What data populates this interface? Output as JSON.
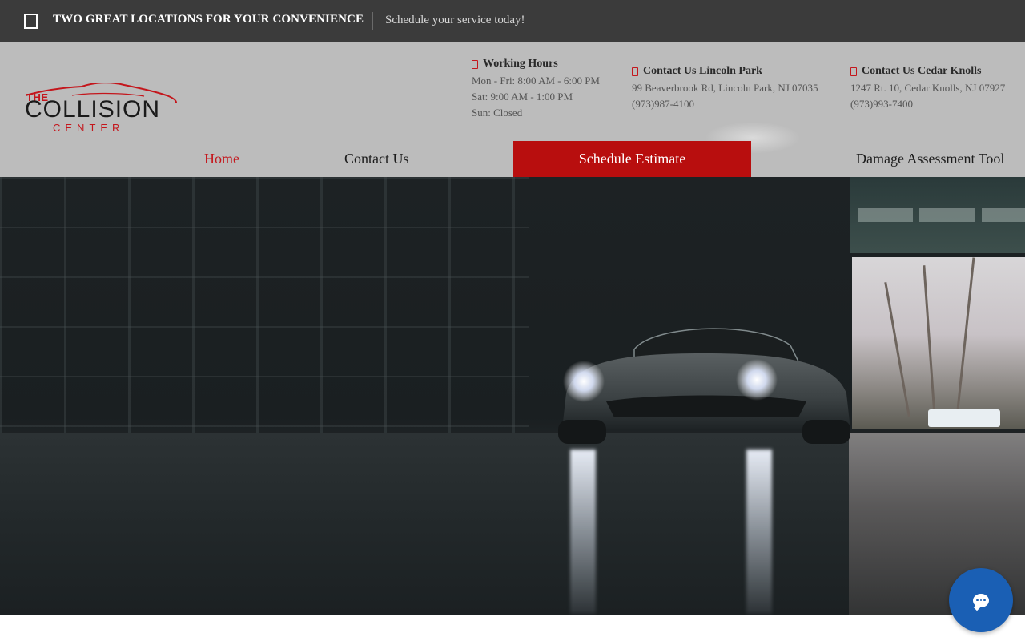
{
  "topbar": {
    "headline": "TWO GREAT LOCATIONS FOR YOUR CONVENIENCE",
    "cta": "Schedule your service today!",
    "icon": "square-icon"
  },
  "logo": {
    "the": "THE",
    "word": "COLLISION",
    "center": "CENTER",
    "brand_red": "#c4161c",
    "brand_dark": "#1a1a1a"
  },
  "hours": {
    "title": "Working Hours",
    "lines": [
      "Mon - Fri: 8:00 AM - 6:00 PM",
      "Sat: 9:00 AM - 1:00 PM",
      "Sun: Closed"
    ]
  },
  "lincoln_park": {
    "title": "Contact Us Lincoln Park",
    "address": "99 Beaverbrook Rd, Lincoln Park, NJ 07035",
    "phone": "(973)987-4100"
  },
  "cedar_knolls": {
    "title": "Contact Us Cedar Knolls",
    "address": "1247 Rt. 10, Cedar Knolls, NJ 07927",
    "phone": "(973)993-7400"
  },
  "nav": {
    "home": "Home",
    "contact": "Contact Us",
    "schedule": "Schedule Estimate",
    "damage": "Damage Assessment Tool",
    "active_color": "#c4161c",
    "cta_bg": "#b80e0e"
  },
  "chat": {
    "icon": "chat-bubble-icon",
    "color": "#1a5fb4"
  }
}
